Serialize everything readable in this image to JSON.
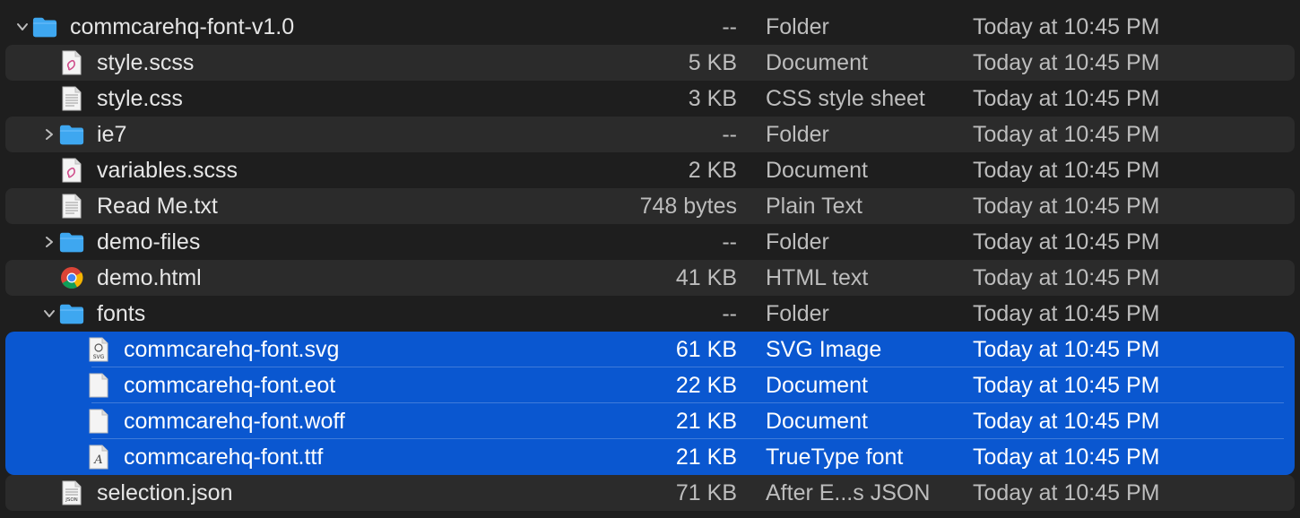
{
  "rows": [
    {
      "name": "commcarehq-font-v1.0",
      "size": "--",
      "kind": "Folder",
      "date": "Today at 10:45 PM",
      "icon": "folder-icon",
      "level": 0,
      "disclosure": "expanded"
    },
    {
      "name": "style.scss",
      "size": "5 KB",
      "kind": "Document",
      "date": "Today at 10:45 PM",
      "icon": "sass-document-icon",
      "level": 1,
      "disclosure": "none"
    },
    {
      "name": "style.css",
      "size": "3 KB",
      "kind": "CSS style sheet",
      "date": "Today at 10:45 PM",
      "icon": "text-document-icon",
      "level": 1,
      "disclosure": "none"
    },
    {
      "name": "ie7",
      "size": "--",
      "kind": "Folder",
      "date": "Today at 10:45 PM",
      "icon": "folder-icon",
      "level": 1,
      "disclosure": "collapsed"
    },
    {
      "name": "variables.scss",
      "size": "2 KB",
      "kind": "Document",
      "date": "Today at 10:45 PM",
      "icon": "sass-document-icon",
      "level": 1,
      "disclosure": "none"
    },
    {
      "name": "Read Me.txt",
      "size": "748 bytes",
      "kind": "Plain Text",
      "date": "Today at 10:45 PM",
      "icon": "text-document-icon",
      "level": 1,
      "disclosure": "none"
    },
    {
      "name": "demo-files",
      "size": "--",
      "kind": "Folder",
      "date": "Today at 10:45 PM",
      "icon": "folder-icon",
      "level": 1,
      "disclosure": "collapsed"
    },
    {
      "name": "demo.html",
      "size": "41 KB",
      "kind": "HTML text",
      "date": "Today at 10:45 PM",
      "icon": "chrome-icon",
      "level": 1,
      "disclosure": "none"
    },
    {
      "name": "fonts",
      "size": "--",
      "kind": "Folder",
      "date": "Today at 10:45 PM",
      "icon": "folder-icon",
      "level": 1,
      "disclosure": "expanded"
    },
    {
      "name": "commcarehq-font.svg",
      "size": "61 KB",
      "kind": "SVG Image",
      "date": "Today at 10:45 PM",
      "icon": "svg-document-icon",
      "level": 2,
      "disclosure": "none",
      "selected": true
    },
    {
      "name": "commcarehq-font.eot",
      "size": "22 KB",
      "kind": "Document",
      "date": "Today at 10:45 PM",
      "icon": "blank-document-icon",
      "level": 2,
      "disclosure": "none",
      "selected": true
    },
    {
      "name": "commcarehq-font.woff",
      "size": "21 KB",
      "kind": "Document",
      "date": "Today at 10:45 PM",
      "icon": "blank-document-icon",
      "level": 2,
      "disclosure": "none",
      "selected": true
    },
    {
      "name": "commcarehq-font.ttf",
      "size": "21 KB",
      "kind": "TrueType font",
      "date": "Today at 10:45 PM",
      "icon": "font-document-icon",
      "level": 2,
      "disclosure": "none",
      "selected": true
    },
    {
      "name": "selection.json",
      "size": "71 KB",
      "kind": "After E...s JSON",
      "date": "Today at 10:45 PM",
      "icon": "json-document-icon",
      "level": 1,
      "disclosure": "none"
    }
  ],
  "icon_labels": {
    "svg": "SVG",
    "json": "JSON",
    "font": "A"
  },
  "colors": {
    "selection": "#0a57d0",
    "folder": "#3ea7f0",
    "row_alt": "#2b2b2b",
    "background": "#1e1e1e"
  }
}
